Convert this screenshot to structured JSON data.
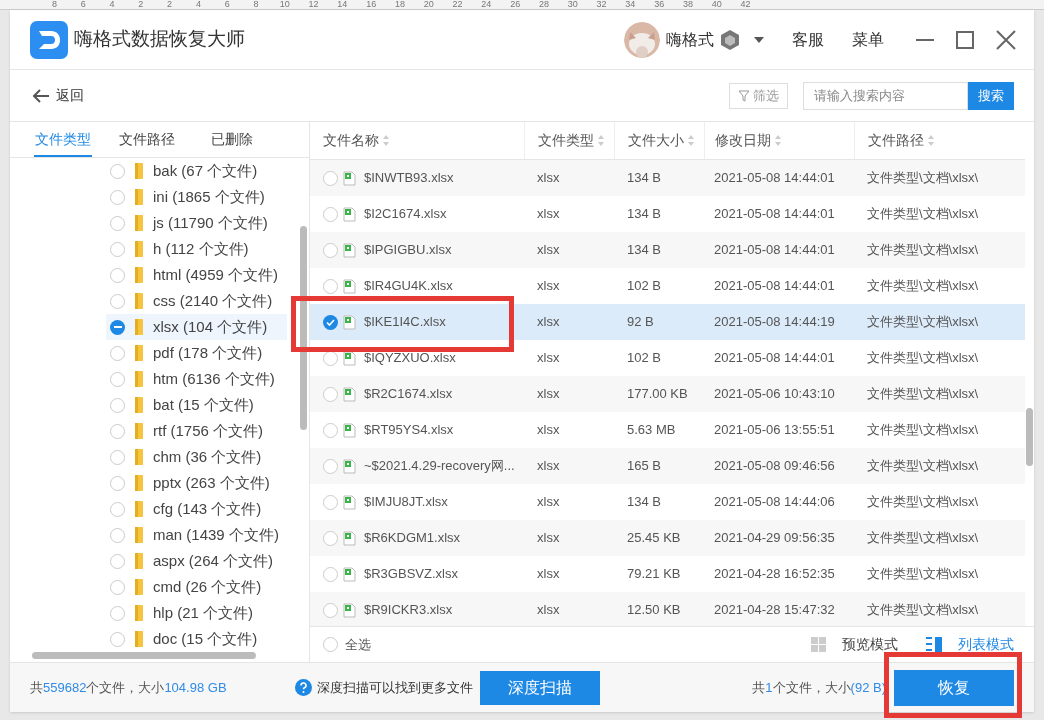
{
  "ruler": {
    "labels": [
      "8",
      "6",
      "4",
      "2",
      "2",
      "4",
      "6",
      "8",
      "10",
      "12",
      "14",
      "16",
      "18",
      "20",
      "22",
      "24",
      "26",
      "28",
      "30",
      "32",
      "34",
      "36",
      "38",
      "40",
      "42"
    ]
  },
  "window": {
    "title": "嗨格式数据恢复大师",
    "user": "嗨格式",
    "links": [
      "客服",
      "菜单"
    ]
  },
  "toolbar": {
    "back": "返回",
    "filter": "筛选",
    "search": {
      "placeholder": "请输入搜索内容",
      "button": "搜索"
    }
  },
  "sidebar": {
    "tabs": [
      {
        "label": "文件类型",
        "selected": true
      },
      {
        "label": "文件路径",
        "selected": false
      },
      {
        "label": "已删除",
        "selected": false
      }
    ],
    "items": [
      {
        "label": "bak (67 个文件)",
        "selected": false
      },
      {
        "label": "ini (1865 个文件)",
        "selected": false
      },
      {
        "label": "js (11790 个文件)",
        "selected": false
      },
      {
        "label": "h (112 个文件)",
        "selected": false
      },
      {
        "label": "html (4959 个文件)",
        "selected": false
      },
      {
        "label": "css (2140 个文件)",
        "selected": false
      },
      {
        "label": "xlsx (104 个文件)",
        "selected": true
      },
      {
        "label": "pdf (178 个文件)",
        "selected": false
      },
      {
        "label": "htm (6136 个文件)",
        "selected": false
      },
      {
        "label": "bat (15 个文件)",
        "selected": false
      },
      {
        "label": "rtf (1756 个文件)",
        "selected": false
      },
      {
        "label": "chm (36 个文件)",
        "selected": false
      },
      {
        "label": "pptx (263 个文件)",
        "selected": false
      },
      {
        "label": "cfg (143 个文件)",
        "selected": false
      },
      {
        "label": "man (1439 个文件)",
        "selected": false
      },
      {
        "label": "aspx (264 个文件)",
        "selected": false
      },
      {
        "label": "cmd (26 个文件)",
        "selected": false
      },
      {
        "label": "hlp (21 个文件)",
        "selected": false
      },
      {
        "label": "doc (15 个文件)",
        "selected": false
      }
    ]
  },
  "table": {
    "columns": [
      "文件名称",
      "文件类型",
      "文件大小",
      "修改日期",
      "文件路径"
    ],
    "rows": [
      {
        "cells": [
          "$INWTB93.xlsx",
          "xlsx",
          "134 B",
          "2021-05-08 14:44:01",
          "文件类型\\文档\\xlsx\\"
        ],
        "selected": false
      },
      {
        "cells": [
          "$I2C1674.xlsx",
          "xlsx",
          "134 B",
          "2021-05-08 14:44:01",
          "文件类型\\文档\\xlsx\\"
        ],
        "selected": false
      },
      {
        "cells": [
          "$IPGIGBU.xlsx",
          "xlsx",
          "134 B",
          "2021-05-08 14:44:01",
          "文件类型\\文档\\xlsx\\"
        ],
        "selected": false
      },
      {
        "cells": [
          "$IR4GU4K.xlsx",
          "xlsx",
          "102 B",
          "2021-05-08 14:44:01",
          "文件类型\\文档\\xlsx\\"
        ],
        "selected": false
      },
      {
        "cells": [
          "$IKE1I4C.xlsx",
          "xlsx",
          "92 B",
          "2021-05-08 14:44:19",
          "文件类型\\文档\\xlsx\\"
        ],
        "selected": true
      },
      {
        "cells": [
          "$IQYZXUO.xlsx",
          "xlsx",
          "102 B",
          "2021-05-08 14:44:01",
          "文件类型\\文档\\xlsx\\"
        ],
        "selected": false
      },
      {
        "cells": [
          "$R2C1674.xlsx",
          "xlsx",
          "177.00 KB",
          "2021-05-06 10:43:10",
          "文件类型\\文档\\xlsx\\"
        ],
        "selected": false
      },
      {
        "cells": [
          "$RT95YS4.xlsx",
          "xlsx",
          "5.63 MB",
          "2021-05-06 13:55:51",
          "文件类型\\文档\\xlsx\\"
        ],
        "selected": false
      },
      {
        "cells": [
          "~$2021.4.29-recovery网...",
          "xlsx",
          "165 B",
          "2021-05-08 09:46:56",
          "文件类型\\文档\\xlsx\\"
        ],
        "selected": false
      },
      {
        "cells": [
          "$IMJU8JT.xlsx",
          "xlsx",
          "134 B",
          "2021-05-08 14:44:06",
          "文件类型\\文档\\xlsx\\"
        ],
        "selected": false
      },
      {
        "cells": [
          "$R6KDGM1.xlsx",
          "xlsx",
          "25.45 KB",
          "2021-04-29 09:56:35",
          "文件类型\\文档\\xlsx\\"
        ],
        "selected": false
      },
      {
        "cells": [
          "$R3GBSVZ.xlsx",
          "xlsx",
          "79.21 KB",
          "2021-04-28 16:52:35",
          "文件类型\\文档\\xlsx\\"
        ],
        "selected": false
      },
      {
        "cells": [
          "$R9ICKR3.xlsx",
          "xlsx",
          "12.50 KB",
          "2021-04-28 15:47:32",
          "文件类型\\文档\\xlsx\\"
        ],
        "selected": false
      }
    ]
  },
  "table_footer": {
    "select_all": {
      "label": "全选",
      "checked": false
    },
    "views": [
      {
        "label": "预览模式",
        "selected": false
      },
      {
        "label": "列表模式",
        "selected": true
      }
    ]
  },
  "status_bar": {
    "total": [
      {
        "text": "共",
        "highlight": false
      },
      {
        "text": "559682",
        "highlight": true
      },
      {
        "text": "个文件，大小",
        "highlight": false
      },
      {
        "text": "104.98 GB",
        "highlight": true
      }
    ],
    "hint": "深度扫描可以找到更多文件",
    "deep_scan": "深度扫描",
    "picked": [
      {
        "text": "共",
        "highlight": false
      },
      {
        "text": "1",
        "highlight": true
      },
      {
        "text": "个文件，大小",
        "highlight": false
      },
      {
        "text": "(92 B)",
        "highlight": true
      }
    ],
    "recover": "恢复"
  }
}
